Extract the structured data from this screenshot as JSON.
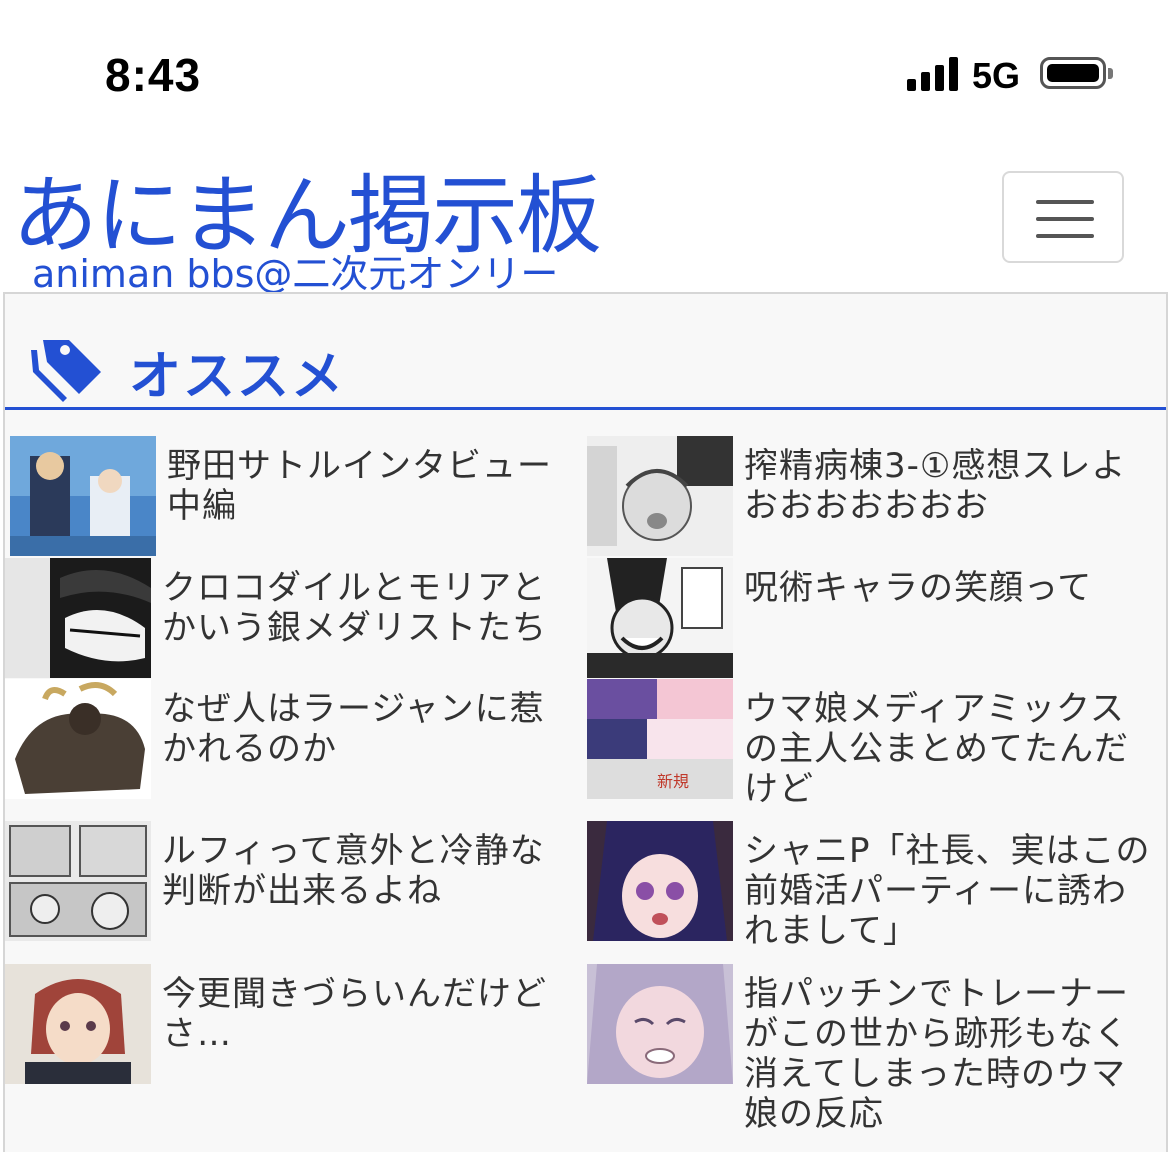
{
  "status_bar": {
    "time": "8:43",
    "network": "5G"
  },
  "header": {
    "logo_title": "あにまん掲示板",
    "logo_subtitle": "animan bbs@二次元オンリー",
    "menu_icon": "hamburger-menu-icon"
  },
  "section": {
    "icon": "tag-icon",
    "title": "オススメ",
    "accent_color": "#2350d3"
  },
  "recommended": [
    {
      "title": "野田サトルインタビュー中編"
    },
    {
      "title": "搾精病棟3-①感想スレよおおおおおおお"
    },
    {
      "title": "クロコダイルとモリアとかいう銀メダリストたち"
    },
    {
      "title": "呪術キャラの笑顔って"
    },
    {
      "title": "なぜ人はラージャンに惹かれるのか"
    },
    {
      "title": "ウマ娘メディアミックスの主人公まとめてたんだけど"
    },
    {
      "title": "ルフィって意外と冷静な判断が出来るよね"
    },
    {
      "title": "シャニP「社長、実はこの前婚活パーティーに誘われまして」"
    },
    {
      "title": "今更聞きづらいんだけどさ…"
    },
    {
      "title": "指パッチンでトレーナーがこの世から跡形もなく消えてしまった時のウマ娘の反応"
    }
  ]
}
